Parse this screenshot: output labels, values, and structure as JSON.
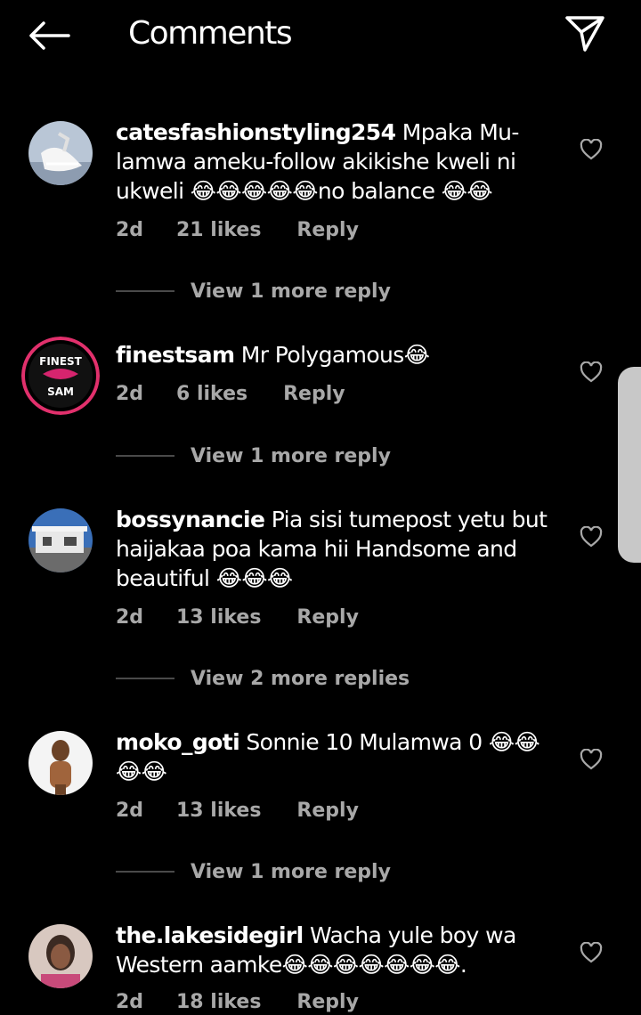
{
  "header": {
    "title": "Comments",
    "back_icon": "arrow-left-icon",
    "send_icon": "paper-plane-icon"
  },
  "comments": [
    {
      "username": "catesfashionstyling254",
      "text": "Mpaka Mu-lamwa ameku-follow akikishe kweli ni ukweli 😂😂😂😂😂no balance 😂😂",
      "time": "2d",
      "likes": "21 likes",
      "reply": "Reply",
      "view_replies": "View 1 more reply"
    },
    {
      "username": "finestsam",
      "text": "Mr Polygamous😂",
      "time": "2d",
      "likes": "6 likes",
      "reply": "Reply",
      "view_replies": "View 1 more reply",
      "avatar_text_1": "FINEST",
      "avatar_text_2": "SAM"
    },
    {
      "username": "bossynancie",
      "text": "Pia sisi tumepost yetu but haijakaa poa kama hii Handsome and beautiful 😂😂😂",
      "time": "2d",
      "likes": "13 likes",
      "reply": "Reply",
      "view_replies": "View 2 more replies"
    },
    {
      "username": "moko_goti",
      "text": "Sonnie 10 Mulamwa 0 😂😂😂😂",
      "time": "2d",
      "likes": "13 likes",
      "reply": "Reply",
      "view_replies": "View 1 more reply"
    },
    {
      "username": "the.lakesidegirl",
      "text": "Wacha yule boy wa Western aamke😂😂😂😂😂😂😂.",
      "time": "2d",
      "likes": "18 likes",
      "reply": "Reply"
    }
  ],
  "colors": {
    "background": "#000000",
    "text_primary": "#ffffff",
    "text_secondary": "#a8a8a8",
    "avatar_ring": "#e1306c"
  }
}
